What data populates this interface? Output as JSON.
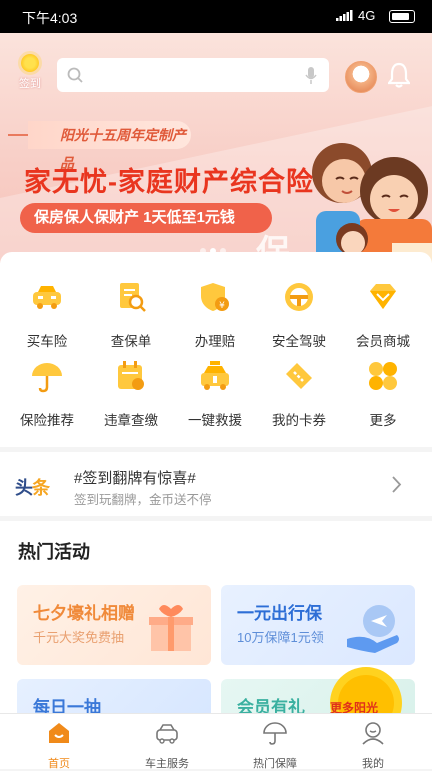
{
  "status_bar": {
    "time": "下午4:03",
    "network": "4G",
    "network_sub": "ıll"
  },
  "header": {
    "checkin_label": "签到",
    "search_placeholder": ""
  },
  "banner": {
    "tag": "阳光十五周年定制产品",
    "headline": "家无忧-家庭财产综合险",
    "subline": "保房保人保财产  1天低至1元钱",
    "corner_char": "保",
    "active_dot": 1
  },
  "menu": {
    "items": [
      {
        "label": "买车险",
        "icon": "car-insurance-icon"
      },
      {
        "label": "查保单",
        "icon": "policy-search-icon"
      },
      {
        "label": "办理赔",
        "icon": "claim-shield-icon"
      },
      {
        "label": "安全驾驶",
        "icon": "steering-wheel-icon"
      },
      {
        "label": "会员商城",
        "icon": "diamond-icon"
      },
      {
        "label": "保险推荐",
        "icon": "umbrella-icon"
      },
      {
        "label": "违章查缴",
        "icon": "violation-calendar-icon"
      },
      {
        "label": "一键救援",
        "icon": "rescue-car-icon"
      },
      {
        "label": "我的卡券",
        "icon": "coupon-icon"
      },
      {
        "label": "更多",
        "icon": "more-grid-icon"
      }
    ]
  },
  "news": {
    "logo_a": "头",
    "logo_b": "条",
    "title": "#签到翻牌有惊喜#",
    "subtitle": "签到玩翻牌，金币送不停"
  },
  "hot": {
    "title": "热门活动",
    "cards": [
      {
        "title": "七夕壕礼相赠",
        "subtitle": "千元大奖免费抽",
        "title_color": "#f08a3a",
        "sub_color": "#e9a070"
      },
      {
        "title": "一元出行保",
        "subtitle": "10万保障1元领",
        "title_color": "#2d6ed6",
        "sub_color": "#5e8ed8"
      },
      {
        "title": "每日一抽",
        "subtitle": "",
        "title_color": "#3a78d8",
        "sub_color": "#5e8ed8"
      },
      {
        "title": "会员有礼",
        "subtitle": "",
        "title_color": "#3ab0a0",
        "sub_color": "#5e8ed8"
      }
    ],
    "sun_badge": "更多阳光"
  },
  "tabs": [
    {
      "label": "首页",
      "icon": "home-icon",
      "active": true
    },
    {
      "label": "车主服务",
      "icon": "car-service-icon",
      "active": false
    },
    {
      "label": "热门保障",
      "icon": "umbrella-tab-icon",
      "active": false
    },
    {
      "label": "我的",
      "icon": "profile-icon",
      "active": false
    }
  ]
}
